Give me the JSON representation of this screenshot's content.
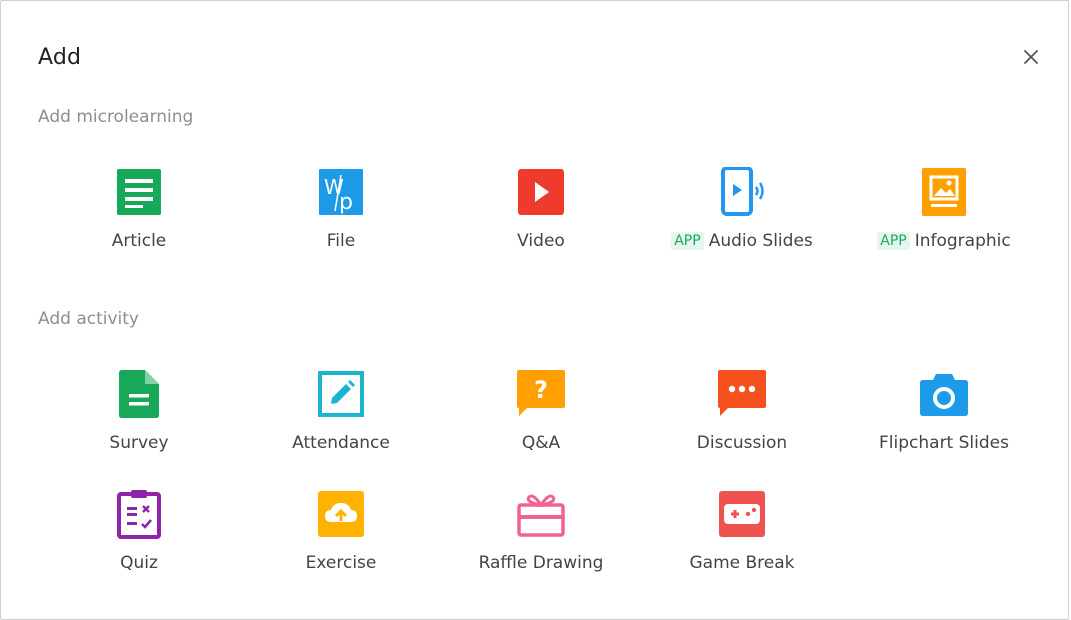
{
  "dialog": {
    "title": "Add"
  },
  "sections": {
    "microlearning": {
      "label": "Add microlearning",
      "items": [
        {
          "label": "Article",
          "icon": "article-icon",
          "color": "#18a85a"
        },
        {
          "label": "File",
          "icon": "file-word-icon",
          "color": "#1e9be8"
        },
        {
          "label": "Video",
          "icon": "video-play-icon",
          "color": "#ef3b2c"
        },
        {
          "label": "Audio Slides",
          "badge": "APP",
          "icon": "audio-slides-icon",
          "color": "#2196f3"
        },
        {
          "label": "Infographic",
          "badge": "APP",
          "icon": "infographic-icon",
          "color": "#ffa000"
        }
      ]
    },
    "activity": {
      "label": "Add activity",
      "items": [
        {
          "label": "Survey",
          "icon": "survey-document-icon",
          "color": "#18a85a"
        },
        {
          "label": "Attendance",
          "icon": "attendance-pencil-icon",
          "color": "#1ab5cf"
        },
        {
          "label": "Q&A",
          "icon": "question-bubble-icon",
          "color": "#ffa000"
        },
        {
          "label": "Discussion",
          "icon": "discussion-bubble-icon",
          "color": "#f4511e"
        },
        {
          "label": "Flipchart Slides",
          "icon": "camera-icon",
          "color": "#1e9be8"
        },
        {
          "label": "Quiz",
          "icon": "quiz-clipboard-icon",
          "color": "#8e24aa"
        },
        {
          "label": "Exercise",
          "icon": "exercise-cloud-upload-icon",
          "color": "#ffb300"
        },
        {
          "label": "Raffle Drawing",
          "icon": "raffle-gift-icon",
          "color": "#f06292"
        },
        {
          "label": "Game Break",
          "icon": "game-controller-icon",
          "color": "#ef5350"
        }
      ]
    }
  }
}
